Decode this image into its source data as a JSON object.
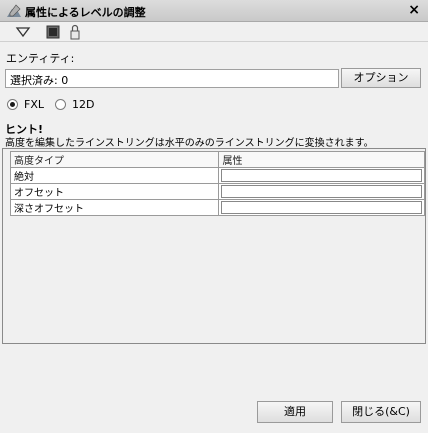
{
  "window": {
    "title": "属性によるレベルの調整",
    "close_label": "×"
  },
  "toolbar": {
    "icons": [
      "filter-icon",
      "monitor-icon",
      "lock-icon"
    ]
  },
  "entity": {
    "label": "エンティティ:",
    "value": "選択済み: 0",
    "options_button": "オプション"
  },
  "format": {
    "options": [
      "FXL",
      "12D"
    ],
    "selected": "FXL"
  },
  "hint": {
    "title": "ヒント!",
    "text": "高度を編集したラインストリングは水平のみのラインストリングに変換されます。"
  },
  "table": {
    "headers": [
      "高度タイプ",
      "属性"
    ],
    "rows": [
      {
        "name": "絶対",
        "value": ""
      },
      {
        "name": "オフセット",
        "value": ""
      },
      {
        "name": "深さオフセット",
        "value": ""
      }
    ]
  },
  "buttons": {
    "apply": "適用",
    "close": "閉じる(&C)"
  }
}
